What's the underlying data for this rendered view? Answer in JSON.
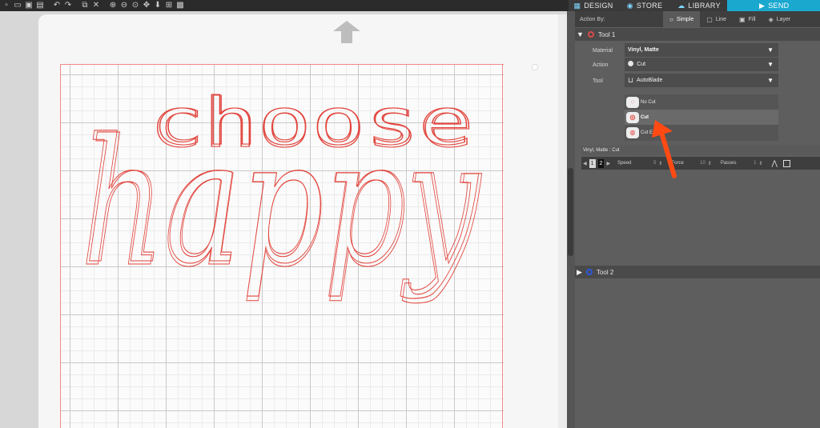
{
  "toolbar": {
    "icons": [
      "new-file-icon",
      "open-file-icon",
      "save-icon",
      "print-icon",
      "undo-icon",
      "redo-icon",
      "copy-icon",
      "delete-icon",
      "zoom-in-icon",
      "zoom-out-icon",
      "zoom-fit-icon",
      "pan-icon",
      "move-down-icon",
      "add-page-icon",
      "texture-icon"
    ]
  },
  "nav": {
    "tabs": [
      {
        "label": "DESIGN",
        "icon": "grid-icon"
      },
      {
        "label": "STORE",
        "icon": "s-icon"
      },
      {
        "label": "LIBRARY",
        "icon": "cloud-icon"
      },
      {
        "label": "SEND",
        "icon": "send-icon",
        "active": true
      }
    ]
  },
  "artwork": {
    "line1": "choose",
    "line2": "happy"
  },
  "panel": {
    "action_by_label": "Action By:",
    "modes": [
      {
        "label": "Simple",
        "active": true
      },
      {
        "label": "Line"
      },
      {
        "label": "Fill"
      },
      {
        "label": "Layer"
      }
    ],
    "tool1": {
      "label": "Tool 1",
      "material_label": "Material",
      "material_value": "Vinyl, Matte",
      "action_label": "Action",
      "action_value": "Cut",
      "tool_label": "Tool",
      "tool_value": "AutoBlade",
      "options": [
        {
          "label": "No Cut"
        },
        {
          "label": "Cut",
          "selected": true
        },
        {
          "label": "Cut E"
        }
      ],
      "settings_title": "Vinyl, Matte : Cut",
      "blade_1": "1",
      "blade_2": "2",
      "speed_label": "Speed",
      "speed_value": "5",
      "force_label": "Force",
      "force_value": "10",
      "passes_label": "Passes",
      "passes_value": "1"
    },
    "tool2": {
      "label": "Tool 2"
    }
  },
  "colors": {
    "cut_line": "#e2453d",
    "send_tab": "#1aa8cf",
    "arrow": "#ff4a14"
  }
}
